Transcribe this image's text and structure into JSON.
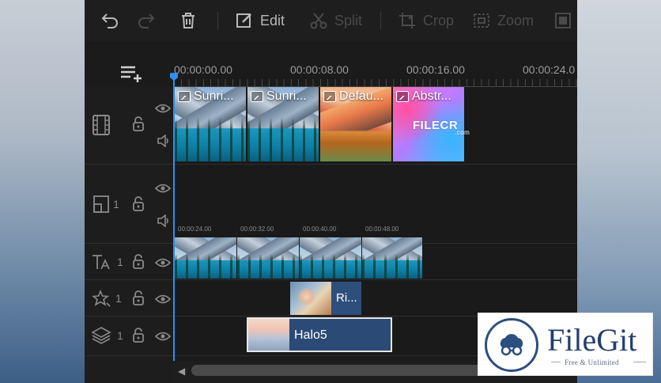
{
  "toolbar": {
    "edit_label": "Edit",
    "split_label": "Split",
    "crop_label": "Crop",
    "zoom_label": "Zoom"
  },
  "ruler": {
    "labels": [
      "00:00:00.00",
      "00:00:08.00",
      "00:00:16.00",
      "00:00:24.0"
    ]
  },
  "tracks": {
    "video": {
      "clips": [
        {
          "label": "Sunri..."
        },
        {
          "label": "Sunri..."
        },
        {
          "label": "Defau..."
        },
        {
          "label": "Abstr..."
        }
      ],
      "watermark": "FILECR",
      "watermark_sub": ".com"
    },
    "overlay": {
      "count": "1",
      "mini_times": [
        "00:00:24.00",
        "00:00:32.00",
        "00:00:40.00",
        "00:00:48.00"
      ]
    },
    "text": {
      "count": "1"
    },
    "effects": {
      "count": "1",
      "clip_label": "Ri..."
    },
    "filters": {
      "count": "1",
      "clip_label": "Halo5"
    }
  },
  "brand_badge": {
    "title": "FileGit",
    "subtitle": "Free & Unlimited"
  },
  "colors": {
    "accent": "#2f8ff0",
    "app_bg": "#1b1b1b",
    "brand": "#243f6e"
  }
}
